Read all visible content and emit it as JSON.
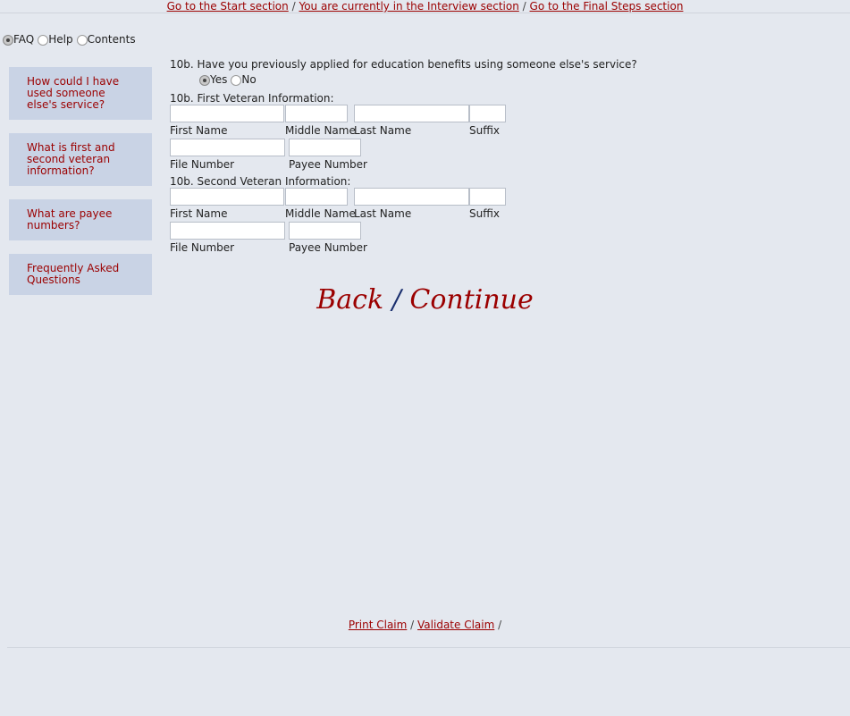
{
  "top_nav": {
    "start_link": "Go to the Start section",
    "current_link": "You are currently in the Interview section",
    "final_link": "Go to the Final Steps section",
    "separator": "/"
  },
  "panel_tabs": {
    "faq": "FAQ",
    "help": "Help",
    "contents": "Contents",
    "selected": "FAQ"
  },
  "faq_items": [
    "How could I have used someone else's service?",
    "What is first and second veteran information?",
    "What are payee numbers?",
    "Frequently Asked Questions"
  ],
  "question": {
    "text": "10b. Have you previously applied for education benefits using someone else's service?",
    "yes": "Yes",
    "no": "No",
    "selected": "Yes"
  },
  "first_veteran": {
    "heading": "10b. First Veteran Information:",
    "first_name": "First Name",
    "middle_name": "Middle Name",
    "last_name": "Last Name",
    "suffix": "Suffix",
    "file_number": "File Number",
    "payee_number": "Payee Number"
  },
  "second_veteran": {
    "heading": "10b. Second Veteran Information:",
    "first_name": "First Name",
    "middle_name": "Middle Name",
    "last_name": "Last Name",
    "suffix": "Suffix",
    "file_number": "File Number",
    "payee_number": "Payee Number"
  },
  "actions": {
    "back": "Back",
    "continue": "Continue",
    "separator": "/"
  },
  "bottom_nav": {
    "print": "Print Claim",
    "validate": "Validate Claim",
    "separator": "/"
  },
  "colors": {
    "background": "#e4e8ef",
    "link": "#9b0000",
    "faq_box": "#c9d3e5",
    "slash": "#1a2f6e"
  }
}
